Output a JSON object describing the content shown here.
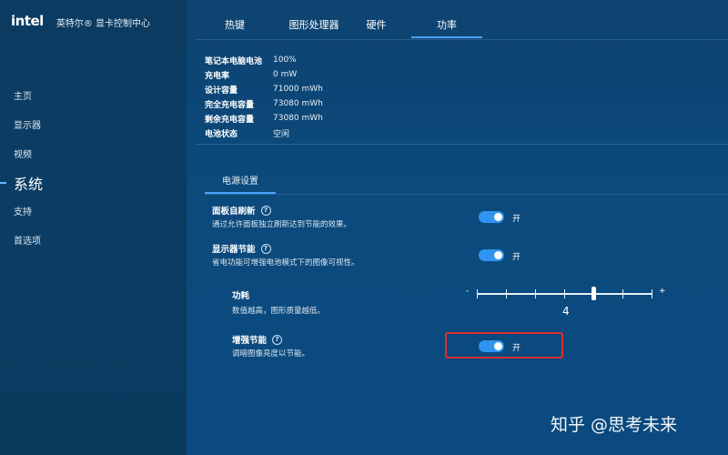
{
  "app": {
    "logo": "intel",
    "title": "英特尔® 显卡控制中心"
  },
  "nav": {
    "items": [
      {
        "label": "主页"
      },
      {
        "label": "显示器"
      },
      {
        "label": "视频"
      },
      {
        "label": "系统",
        "active": true
      },
      {
        "label": "支持"
      },
      {
        "label": "首选项"
      }
    ]
  },
  "tabs": [
    {
      "label": "热键"
    },
    {
      "label": "图形处理器"
    },
    {
      "label": "硬件"
    },
    {
      "label": "功率",
      "active": true
    }
  ],
  "battery": [
    {
      "label": "笔记本电脑电池",
      "value": "100%"
    },
    {
      "label": "充电率",
      "value": "0 mW"
    },
    {
      "label": "设计容量",
      "value": "71000 mWh"
    },
    {
      "label": "完全充电容量",
      "value": "73080 mWh"
    },
    {
      "label": "剩余充电容量",
      "value": "73080 mWh"
    },
    {
      "label": "电池状态",
      "value": "空闲"
    }
  ],
  "power_settings": {
    "subtab": "电源设置",
    "panel_self_refresh": {
      "title": "面板自刷新",
      "help": "?",
      "description": "通过允许面板独立刷新达到节能的效果。",
      "state": "开"
    },
    "display_power_saving": {
      "title": "显示器节能",
      "help": "?",
      "description": "省电功能可增强电池模式下的图像可视性。",
      "state": "开"
    },
    "power_consumption": {
      "title": "功耗",
      "description": "数值越高，图形质量越低。",
      "minus": "-",
      "plus": "+",
      "value": "4",
      "level": 4,
      "max": 6
    },
    "enhanced_power_saving": {
      "title": "增强节能",
      "help": "?",
      "description": "调暗图像亮度以节能。",
      "state": "开"
    }
  },
  "watermark": "知乎 @思考未来",
  "colors": {
    "accent": "#2f95f0",
    "highlight_border": "#e02d2d"
  }
}
